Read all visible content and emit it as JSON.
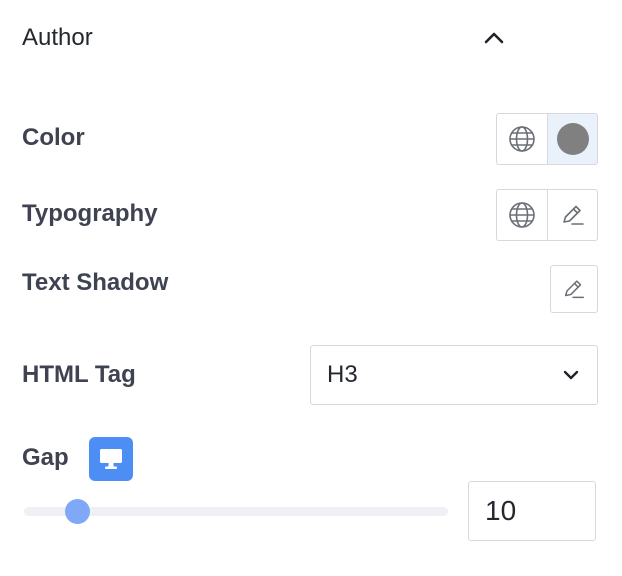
{
  "section": {
    "title": "Author"
  },
  "controls": {
    "color": {
      "label": "Color",
      "swatch": "#808080"
    },
    "typography": {
      "label": "Typography"
    },
    "text_shadow": {
      "label": "Text Shadow"
    },
    "html_tag": {
      "label": "HTML Tag",
      "value": "H3"
    },
    "gap": {
      "label": "Gap",
      "value": "10",
      "slider_fraction": 0.125
    }
  },
  "icons": {
    "collapse": "chevron-up-icon",
    "global": "globe-icon",
    "edit": "pencil-icon",
    "dropdown": "chevron-down-icon",
    "device": "desktop-icon"
  },
  "colors": {
    "accent": "#4d8ef5",
    "slider_thumb": "#7fa8f7",
    "active_segment": "#e9f1fb"
  }
}
